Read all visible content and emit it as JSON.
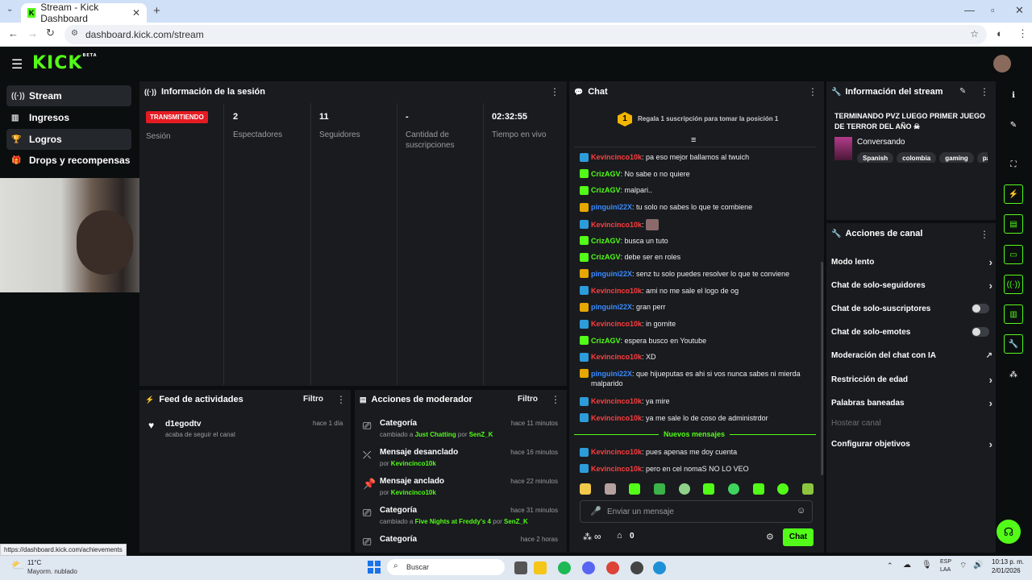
{
  "browser": {
    "tab_title": "Stream - Kick Dashboard",
    "url": "dashboard.kick.com/stream",
    "status_url": "https://dashboard.kick.com/achievements"
  },
  "header": {
    "logo": "KICK",
    "logo_badge": "BETA"
  },
  "sidebar": {
    "items": [
      {
        "label": "Stream",
        "icon": "broadcast-icon"
      },
      {
        "label": "Ingresos",
        "icon": "chart-icon"
      },
      {
        "label": "Logros",
        "icon": "trophy-icon"
      },
      {
        "label": "Drops y recompensas",
        "icon": "gift-icon"
      }
    ]
  },
  "session": {
    "title": "Información de la sesión",
    "status_badge": "TRANSMITIENDO",
    "status_label": "Sesión",
    "stats": [
      {
        "value": "2",
        "label": "Espectadores"
      },
      {
        "value": "11",
        "label": "Seguidores"
      },
      {
        "value": "-",
        "label": "Cantidad de suscripciones"
      },
      {
        "value": "02:32:55",
        "label": "Tiempo en vivo"
      }
    ]
  },
  "feed": {
    "title": "Feed de actividades",
    "filter": "Filtro",
    "items": [
      {
        "user": "d1egodtv",
        "desc": "acaba de seguir el canal",
        "time": "hace 1 día"
      }
    ]
  },
  "modactions": {
    "title": "Acciones de moderador",
    "filter": "Filtro",
    "items": [
      {
        "title": "Categoría",
        "pre": "cambiado a ",
        "target": "Just Chatting",
        "mid": " por ",
        "by": "SenZ_K",
        "time": "hace 11 minutos"
      },
      {
        "title": "Mensaje desanclado",
        "pre": "por ",
        "target": "Kevincinco10k",
        "mid": "",
        "by": "",
        "time": "hace 16 minutos"
      },
      {
        "title": "Mensaje anclado",
        "pre": "por ",
        "target": "Kevincinco10k",
        "mid": "",
        "by": "",
        "time": "hace 22 minutos"
      },
      {
        "title": "Categoría",
        "pre": "cambiado a ",
        "target": "Five Nights at Freddy's 4",
        "mid": " por ",
        "by": "SenZ_K",
        "time": "hace 31 minutos"
      },
      {
        "title": "Categoría",
        "pre": "",
        "target": "",
        "mid": "",
        "by": "",
        "time": "hace 2 horas"
      }
    ]
  },
  "chat": {
    "title": "Chat",
    "gift_prompt": "Regala 1 suscripción para tomar la posición 1",
    "gift_rank": "1",
    "messages": [
      {
        "user": "Kevincinco10k",
        "color": "red",
        "badge": "blue",
        "text": "pa eso mejor ballamos al twuich"
      },
      {
        "user": "CrizAGV",
        "color": "green",
        "badge": "green",
        "text": "No sabe o no quiere"
      },
      {
        "user": "CrizAGV",
        "color": "green",
        "badge": "green",
        "text": "malpari.."
      },
      {
        "user": "pinguini22X",
        "color": "blue",
        "badge": "gold",
        "text": "tu solo no sabes lo que te combiene"
      },
      {
        "user": "Kevincinco10k",
        "color": "red",
        "badge": "blue",
        "text": ""
      },
      {
        "user": "CrizAGV",
        "color": "green",
        "badge": "green",
        "text": "busca un tuto"
      },
      {
        "user": "CrizAGV",
        "color": "green",
        "badge": "green",
        "text": "debe ser en roles"
      },
      {
        "user": "pinguini22X",
        "color": "blue",
        "badge": "gold",
        "text": "senz tu solo puedes resolver lo que te conviene"
      },
      {
        "user": "Kevincinco10k",
        "color": "red",
        "badge": "blue",
        "text": "ami no me sale el logo de og"
      },
      {
        "user": "pinguini22X",
        "color": "blue",
        "badge": "gold",
        "text": "gran perr"
      },
      {
        "user": "Kevincinco10k",
        "color": "red",
        "badge": "blue",
        "text": "in gornite"
      },
      {
        "user": "CrizAGV",
        "color": "green",
        "badge": "green",
        "text": "espera busco en Youtube"
      },
      {
        "user": "Kevincinco10k",
        "color": "red",
        "badge": "blue",
        "text": "XD"
      },
      {
        "user": "pinguini22X",
        "color": "blue",
        "badge": "gold",
        "text": "que hijueputas es ahi si vos nunca sabes ni mierda malparido"
      },
      {
        "user": "Kevincinco10k",
        "color": "red",
        "badge": "blue",
        "text": "ya mire"
      },
      {
        "user": "Kevincinco10k",
        "color": "red",
        "badge": "blue",
        "text": "ya me sale lo de coso de administrdor"
      }
    ],
    "new_messages": "Nuevos mensajes",
    "new": [
      {
        "user": "Kevincinco10k",
        "color": "red",
        "badge": "blue",
        "text": "pues apenas me doy cuenta"
      },
      {
        "user": "Kevincinco10k",
        "color": "red",
        "badge": "blue",
        "text": "pero en cel nomaS NO LO VEO"
      }
    ],
    "input_placeholder": "Enviar un mensaje",
    "points": "0",
    "send": "Chat",
    "infinity": "∞"
  },
  "streaminfo": {
    "title": "Información del stream",
    "stream_title": "TERMINANDO PVZ LUEGO PRIMER JUEGO DE TERROR DEL AÑO ☠",
    "category": "Conversando",
    "tags": [
      "Spanish",
      "colombia",
      "gaming",
      "pas"
    ]
  },
  "channel_actions": {
    "title": "Acciones de canal",
    "items": [
      {
        "label": "Modo lento",
        "kind": "chevron"
      },
      {
        "label": "Chat de solo-seguidores",
        "kind": "chevron"
      },
      {
        "label": "Chat de solo-suscriptores",
        "kind": "toggle"
      },
      {
        "label": "Chat de solo-emotes",
        "kind": "toggle"
      },
      {
        "label": "Moderación del chat con IA",
        "kind": "external"
      },
      {
        "label": "Restricción de edad",
        "kind": "chevron"
      },
      {
        "label": "Palabras baneadas",
        "kind": "chevron"
      },
      {
        "label": "Hostear canal",
        "kind": "disabled"
      },
      {
        "label": "Configurar objetivos",
        "kind": "chevron"
      }
    ]
  },
  "taskbar": {
    "weather_temp": "11°C",
    "weather_desc": "Mayorm. nublado",
    "search": "Buscar",
    "lang": "ESP",
    "lang2": "LAA",
    "time": "10:13 p. m.",
    "date": "2/01/2026"
  },
  "colors": {
    "accent": "#53fc18",
    "live": "#e41b23",
    "panel": "#191b1f"
  }
}
